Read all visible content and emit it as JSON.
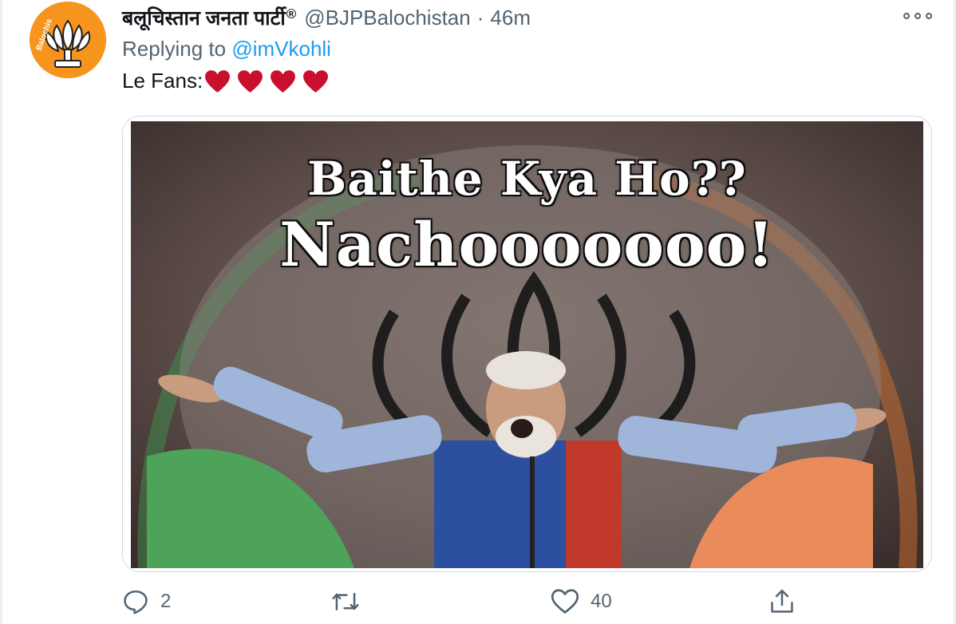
{
  "tweet": {
    "display_name": "बलूचिस्तान जनता पार्टी",
    "verified_mark": "®",
    "handle": "@BJPBalochistan",
    "separator": "·",
    "time": "46m",
    "replying_prefix": "Replying to",
    "replying_to": "@imVkohli",
    "text": "Le Fans:",
    "text_emoji": [
      "red-heart-icon",
      "red-heart-icon",
      "red-heart-icon",
      "red-heart-icon"
    ],
    "avatar_text": "Balochis",
    "media": {
      "caption_line1": "Baithe Kya Ho??",
      "caption_line2": "Nachooooooo!"
    }
  },
  "actions": {
    "reply_count": "2",
    "retweet_count": "",
    "like_count": "40",
    "share_count": ""
  },
  "icons": {
    "reply": "reply-icon",
    "retweet": "retweet-icon",
    "like": "heart-icon",
    "share": "share-icon",
    "more": "more-options-icon"
  },
  "colors": {
    "text_primary": "#0f1419",
    "text_secondary": "#536471",
    "mention": "#1d9bf0",
    "avatar_bg": "#f7941d",
    "heart_emoji": "#c8102e"
  }
}
